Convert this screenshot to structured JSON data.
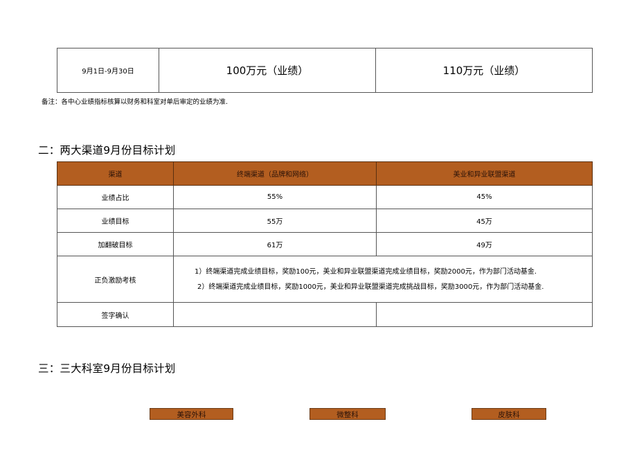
{
  "period_table": {
    "date_range": "9月1日-9月30日",
    "target_1": "100万元（业绩）",
    "target_2": "110万元（业绩）"
  },
  "note": "备注：各中心业绩指标核算以财务和科室对单后审定的业绩为准.",
  "section2": {
    "heading": "二：两大渠道9月份目标计划",
    "header": [
      "渠道",
      "终端渠道（品牌和网络）",
      "美业和异业联盟渠道"
    ],
    "rows": [
      {
        "label": "业绩占比",
        "a": "55%",
        "b": "45%"
      },
      {
        "label": "业绩目标",
        "a": "55万",
        "b": "45万"
      },
      {
        "label": "加翻破目标",
        "a": "61万",
        "b": "49万"
      }
    ],
    "incentive": {
      "label": "正负激励考核",
      "rule_1": "1）终端渠道完成业绩目标，奖励100元，美业和异业联盟渠道完成业绩目标，奖励2000元，作为部门活动基金.",
      "rule_2": "2）终端渠道完成业绩目标，奖励1000元，美业和异业联盟渠道完成挑战目标，奖励3000元，作为部门活动基金."
    },
    "signature_label": "签字确认"
  },
  "section3": {
    "heading": "三：三大科室9月份目标计划",
    "departments": [
      "美容外科",
      "微整科",
      "皮肤科"
    ]
  },
  "colors": {
    "header_fill": "#b35e20",
    "border": "#555555"
  }
}
